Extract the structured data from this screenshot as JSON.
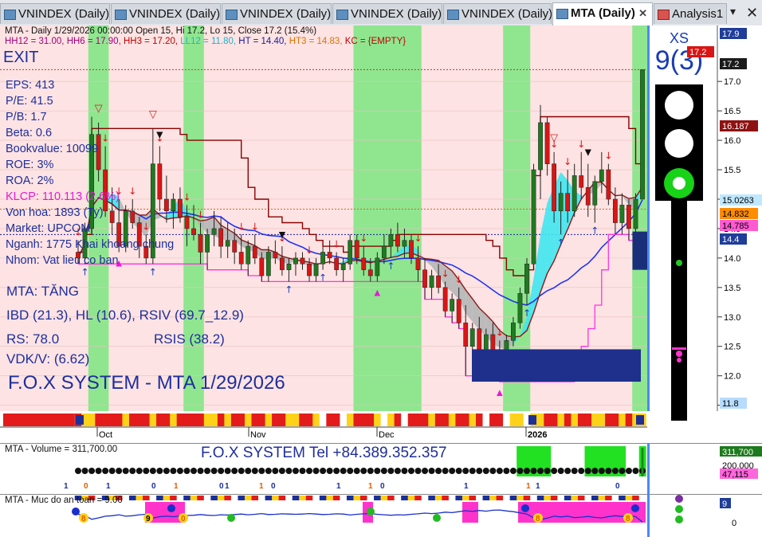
{
  "tabs": [
    {
      "label": "VNINDEX (Daily)"
    },
    {
      "label": "VNINDEX (Daily)"
    },
    {
      "label": "VNINDEX (Daily)"
    },
    {
      "label": "VNINDEX (Daily)"
    },
    {
      "label": "VNINDEX (Daily)"
    },
    {
      "label": "MTA (Daily)",
      "active": true
    },
    {
      "label": "Analysis1"
    }
  ],
  "header": {
    "title": "MTA - Daily 1/29/2026 00:00:00 Open 15, Hi 17.2, Lo 15, Close 17.2 (15.4%)",
    "levels": [
      {
        "text": "HH12 = 31.00,",
        "color": "#a0007a"
      },
      {
        "text": "HH6 = 17.90,",
        "color": "#a0007a"
      },
      {
        "text": "HH3 = 17.20,",
        "color": "#c00000"
      },
      {
        "text": "LL12 = 11.80,",
        "color": "#20b0d0"
      },
      {
        "text": "HT = 14.40,",
        "color": "#1a1a9a"
      },
      {
        "text": "HT3 = 14.83,",
        "color": "#e07000"
      },
      {
        "text": "KC = {EMPTY}",
        "color": "#c00000"
      }
    ]
  },
  "signal": {
    "exit": "EXIT",
    "xs_label": "XS",
    "xs_value": "9(3)"
  },
  "fundamentals": [
    {
      "text": "EPS: 413"
    },
    {
      "text": "P/E: 41.5"
    },
    {
      "text": "P/B: 1.7"
    },
    {
      "text": "Beta: 0.6"
    },
    {
      "text": "Bookvalue: 10099"
    },
    {
      "text": "ROE: 3%"
    },
    {
      "text": "ROA: 2%"
    },
    {
      "text": "KLCP: 110.113 (2.6%)",
      "highlight": true
    },
    {
      "text": "Von hoa: 1893 (Ty)"
    },
    {
      "text": "Market: UPCOM"
    },
    {
      "text": "Nganh: 1775 Khai khoang chung"
    },
    {
      "text": "Nhom: Vat lieu co ban"
    }
  ],
  "indicators": {
    "trend": "MTA: TĂNG",
    "ibd": "IBD (21.3), HL (10.6), RSIV (69.7_12.9)",
    "rs": "RS: 78.0",
    "rsis": "RSIS (38.2)",
    "vdk": "VDK/V:  (6.62)",
    "system": "F.O.X SYSTEM - MTA 1/29/2026"
  },
  "price_axis": {
    "ticks": [
      "17.0",
      "16.5",
      "16.0",
      "15.5",
      "15.0",
      "14.5",
      "14.0",
      "13.5",
      "13.0",
      "12.5",
      "12.0",
      "11.5"
    ],
    "badges": [
      {
        "text": "17.9",
        "bg": "#1f3d99",
        "fg": "#ffffff"
      },
      {
        "text": "17.2",
        "bg": "#d91515",
        "fg": "#ffffff"
      },
      {
        "text": "17.2",
        "bg": "#1b1b1b",
        "fg": "#ffffff"
      },
      {
        "text": "16.187",
        "bg": "#8e1212",
        "fg": "#ffffff"
      },
      {
        "text": "15.0263",
        "bg": "#bfe8ff",
        "fg": "#000000"
      },
      {
        "text": "14.832",
        "bg": "#ff8c00",
        "fg": "#000000"
      },
      {
        "text": "14.785",
        "bg": "#ff5ad2",
        "fg": "#000000"
      },
      {
        "text": "14.4",
        "bg": "#1f3d99",
        "fg": "#ffffff"
      },
      {
        "text": "11.8",
        "bg": "#b7dcff",
        "fg": "#000000"
      }
    ]
  },
  "time_axis": [
    "Oct",
    "Nov",
    "Dec",
    "2026"
  ],
  "volume": {
    "title": "MTA - Volume = 311,700.00",
    "banner": "F.O.X SYSTEM Tel +84.389.352.357",
    "badges": [
      {
        "text": "311,700",
        "bg": "#1e7a1e",
        "fg": "#ffffff"
      },
      {
        "text": "200,000",
        "bg": "#ffffff",
        "fg": "#000000"
      },
      {
        "text": "47,115",
        "bg": "#ff66dd",
        "fg": "#000000"
      }
    ]
  },
  "safety": {
    "title": "MTA - Muc do an toan = 9.00",
    "badges": [
      {
        "text": "9",
        "bg": "#1f3d99",
        "fg": "#ffffff"
      }
    ],
    "tick": "0",
    "markers": [
      "8",
      "9",
      "0",
      "8",
      "8"
    ]
  },
  "mini_numbers": [
    "1",
    "0",
    "1",
    "0",
    "1",
    "0",
    "1",
    "1",
    "0",
    "1",
    "1",
    "0",
    "1",
    "1"
  ],
  "chart_data": {
    "type": "candlestick",
    "title": "MTA - Daily 1/29/2026",
    "ylim": [
      11.4,
      17.95
    ],
    "last": {
      "open": 15,
      "high": 17.2,
      "low": 15,
      "close": 17.2,
      "change_pct": 15.4
    },
    "levels": {
      "HH12": 31.0,
      "HH6": 17.9,
      "HH3": 17.2,
      "LL12": 11.8,
      "HT": 14.4,
      "HT3": 14.83
    },
    "candles": [
      [
        14.1,
        14.3,
        13.9,
        14.0
      ],
      [
        14.0,
        14.6,
        13.9,
        14.5
      ],
      [
        14.5,
        16.4,
        14.4,
        16.1
      ],
      [
        16.1,
        16.3,
        15.3,
        15.5
      ],
      [
        15.5,
        15.9,
        14.7,
        14.8
      ],
      [
        14.8,
        15.2,
        14.4,
        14.6
      ],
      [
        14.6,
        15.0,
        14.1,
        14.2
      ],
      [
        14.2,
        14.9,
        14.1,
        14.8
      ],
      [
        14.8,
        15.0,
        14.5,
        14.6
      ],
      [
        14.6,
        14.7,
        14.0,
        14.2
      ],
      [
        14.2,
        14.4,
        13.9,
        14.0
      ],
      [
        14.0,
        16.2,
        13.9,
        15.6
      ],
      [
        15.6,
        15.9,
        14.8,
        15.0
      ],
      [
        15.0,
        15.4,
        14.6,
        14.8
      ],
      [
        14.8,
        15.1,
        14.5,
        15.0
      ],
      [
        15.0,
        15.2,
        14.6,
        14.7
      ],
      [
        14.7,
        14.9,
        14.2,
        14.5
      ],
      [
        14.5,
        14.9,
        14.3,
        14.4
      ],
      [
        14.4,
        14.6,
        13.9,
        14.1
      ],
      [
        14.1,
        14.5,
        13.8,
        14.4
      ],
      [
        14.4,
        14.8,
        14.2,
        14.5
      ],
      [
        14.5,
        14.7,
        14.0,
        14.2
      ],
      [
        14.2,
        14.6,
        14.0,
        14.3
      ],
      [
        14.3,
        14.5,
        13.9,
        14.1
      ],
      [
        14.1,
        14.4,
        13.8,
        13.9
      ],
      [
        13.9,
        14.3,
        13.7,
        14.2
      ],
      [
        14.2,
        14.4,
        13.9,
        14.0
      ],
      [
        14.0,
        14.1,
        13.6,
        13.7
      ],
      [
        13.7,
        14.2,
        13.6,
        14.1
      ],
      [
        14.1,
        14.3,
        13.9,
        14.0
      ],
      [
        14.0,
        14.2,
        13.7,
        13.8
      ],
      [
        13.8,
        14.0,
        13.6,
        13.9
      ],
      [
        13.9,
        14.1,
        13.7,
        14.0
      ],
      [
        14.0,
        14.1,
        13.8,
        13.9
      ],
      [
        13.9,
        14.0,
        13.6,
        13.7
      ],
      [
        13.7,
        14.0,
        13.6,
        13.9
      ],
      [
        13.9,
        14.2,
        13.8,
        14.1
      ],
      [
        14.1,
        14.3,
        13.9,
        14.0
      ],
      [
        14.0,
        14.1,
        13.7,
        13.8
      ],
      [
        13.8,
        14.0,
        13.6,
        13.9
      ],
      [
        13.9,
        14.4,
        13.8,
        14.3
      ],
      [
        14.3,
        14.4,
        13.9,
        14.0
      ],
      [
        14.0,
        14.2,
        13.7,
        13.8
      ],
      [
        13.8,
        14.0,
        13.6,
        13.7
      ],
      [
        13.7,
        14.1,
        13.6,
        14.0
      ],
      [
        14.0,
        14.4,
        13.9,
        14.2
      ],
      [
        14.2,
        14.5,
        14.0,
        14.4
      ],
      [
        14.4,
        14.6,
        14.1,
        14.2
      ],
      [
        14.2,
        14.5,
        14.0,
        14.3
      ],
      [
        14.3,
        14.4,
        13.9,
        14.0
      ],
      [
        14.0,
        14.2,
        13.6,
        13.8
      ],
      [
        13.8,
        14.0,
        13.3,
        13.5
      ],
      [
        13.5,
        13.8,
        13.3,
        13.7
      ],
      [
        13.7,
        13.9,
        13.4,
        13.5
      ],
      [
        13.5,
        13.6,
        13.0,
        13.1
      ],
      [
        13.1,
        13.4,
        12.9,
        13.3
      ],
      [
        13.3,
        13.5,
        12.8,
        12.9
      ],
      [
        12.9,
        13.2,
        12.0,
        12.5
      ],
      [
        12.5,
        12.9,
        12.2,
        12.8
      ],
      [
        12.8,
        13.0,
        12.3,
        12.4
      ],
      [
        12.4,
        12.8,
        12.1,
        12.7
      ],
      [
        12.7,
        12.9,
        12.2,
        12.3
      ],
      [
        12.3,
        12.6,
        11.9,
        12.2
      ],
      [
        12.2,
        12.7,
        12.1,
        12.6
      ],
      [
        12.6,
        13.0,
        12.5,
        12.9
      ],
      [
        12.9,
        13.5,
        12.8,
        13.4
      ],
      [
        13.4,
        14.0,
        13.2,
        13.9
      ],
      [
        13.9,
        15.6,
        13.8,
        15.5
      ],
      [
        15.5,
        16.6,
        15.0,
        16.3
      ],
      [
        16.3,
        16.4,
        15.4,
        15.6
      ],
      [
        15.6,
        15.8,
        14.6,
        14.8
      ],
      [
        14.8,
        15.3,
        14.4,
        15.1
      ],
      [
        15.1,
        15.5,
        14.6,
        14.8
      ],
      [
        14.8,
        15.6,
        14.7,
        15.4
      ],
      [
        15.4,
        15.8,
        15.0,
        15.2
      ],
      [
        15.2,
        15.6,
        14.7,
        14.9
      ],
      [
        14.9,
        15.4,
        14.6,
        15.3
      ],
      [
        15.3,
        15.8,
        15.1,
        15.5
      ],
      [
        15.5,
        15.6,
        14.9,
        15.0
      ],
      [
        15.0,
        15.2,
        14.4,
        14.6
      ],
      [
        14.6,
        15.1,
        14.4,
        14.9
      ],
      [
        14.9,
        15.0,
        14.3,
        14.5
      ],
      [
        14.5,
        15.1,
        14.4,
        15.0
      ],
      [
        15.0,
        17.2,
        15.0,
        17.2
      ]
    ]
  }
}
